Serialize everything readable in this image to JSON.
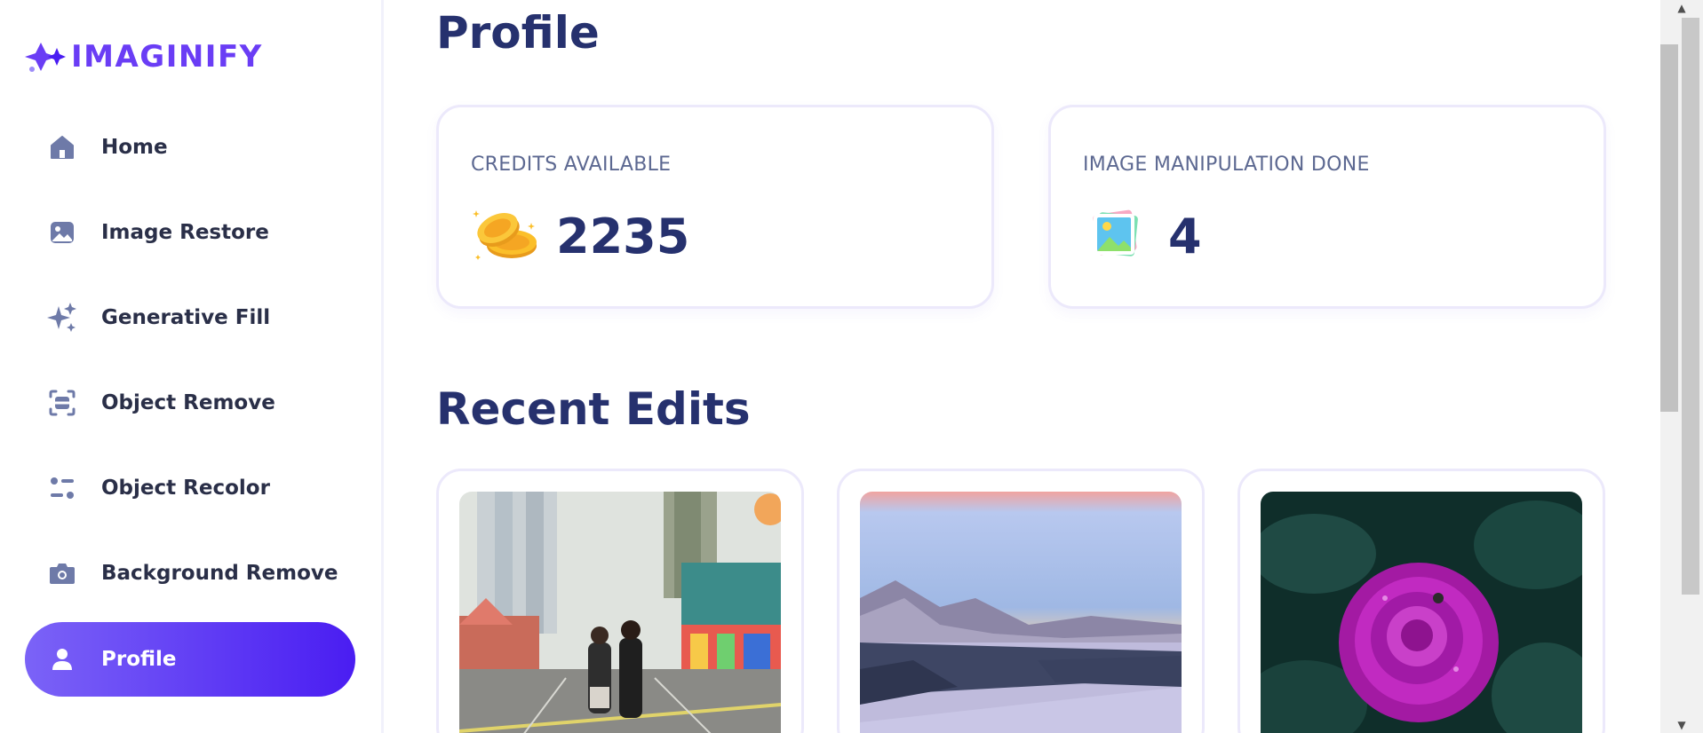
{
  "brand": {
    "name": "IMAGINIFY",
    "color": "#6a3df5"
  },
  "sidebar": {
    "items": [
      {
        "label": "Home",
        "icon": "home-icon",
        "active": false
      },
      {
        "label": "Image Restore",
        "icon": "image-icon",
        "active": false
      },
      {
        "label": "Generative Fill",
        "icon": "sparkles-icon",
        "active": false
      },
      {
        "label": "Object Remove",
        "icon": "scan-icon",
        "active": false
      },
      {
        "label": "Object Recolor",
        "icon": "filter-icon",
        "active": false
      },
      {
        "label": "Background Remove",
        "icon": "camera-icon",
        "active": false
      },
      {
        "label": "Profile",
        "icon": "user-icon",
        "active": true
      }
    ]
  },
  "main": {
    "title": "Profile",
    "stats": [
      {
        "title": "CREDITS AVAILABLE",
        "value": "2235",
        "icon": "coins-icon"
      },
      {
        "title": "IMAGE MANIPULATION DONE",
        "value": "4",
        "icon": "photo-icon"
      }
    ],
    "recent_title": "Recent Edits",
    "recent_edits": [
      {
        "name": "street-fair-photo"
      },
      {
        "name": "snowy-mountain-photo"
      },
      {
        "name": "purple-rose-photo"
      }
    ]
  },
  "colors": {
    "accent_start": "#7b63f7",
    "accent_end": "#4a1df2",
    "heading": "#26316e",
    "muted": "#5c6891"
  }
}
